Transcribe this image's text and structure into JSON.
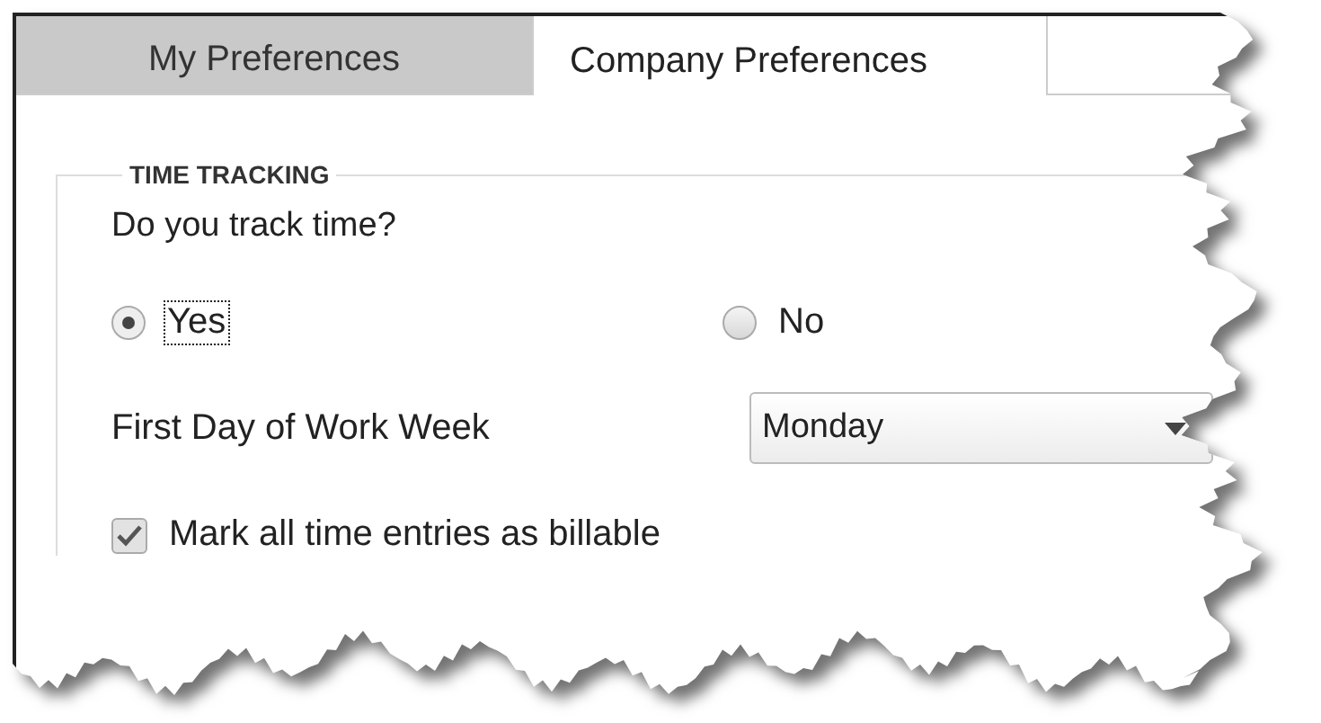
{
  "tabs": [
    {
      "label": "My Preferences",
      "selected": false
    },
    {
      "label": "Company Preferences",
      "selected": true
    }
  ],
  "section": {
    "title": "TIME TRACKING",
    "question": "Do you track time?",
    "options": [
      {
        "label": "Yes",
        "selected": true,
        "focused": true
      },
      {
        "label": "No",
        "selected": false,
        "focused": false
      }
    ],
    "first_day": {
      "label": "First Day of Work Week",
      "value": "Monday"
    },
    "billable": {
      "label": "Mark all time entries as billable",
      "checked": true
    }
  }
}
